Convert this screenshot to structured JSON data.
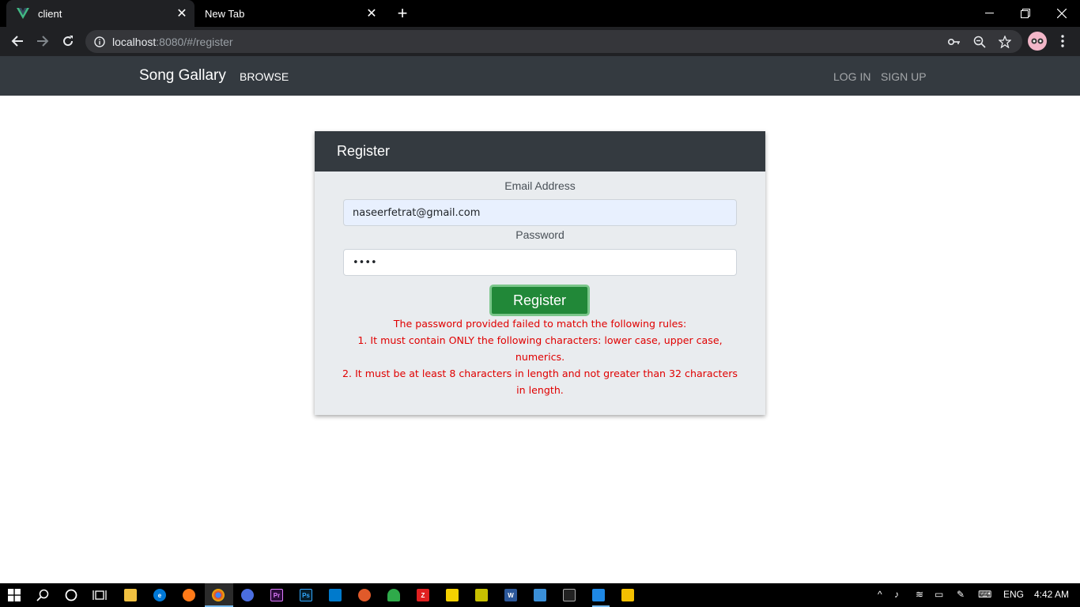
{
  "browser": {
    "tabs": [
      {
        "title": "client",
        "active": true
      },
      {
        "title": "New Tab",
        "active": false
      }
    ],
    "url_host": "localhost",
    "url_rest": ":8080/#/register"
  },
  "navbar": {
    "brand": "Song Gallary",
    "browse": "BROWSE",
    "login": "LOG IN",
    "signup": "SIGN UP"
  },
  "register": {
    "title": "Register",
    "email_label": "Email Address",
    "email_value": "naseerfetrat@gmail.com",
    "password_label": "Password",
    "password_value": "••••",
    "button_label": "Register",
    "errors": [
      "The password provided failed to match the following rules:",
      "1. It must contain ONLY the following characters: lower case, upper case, numerics.",
      "2. It must be at least 8 characters in length and not greater than 32 characters in length."
    ]
  },
  "taskbar": {
    "language": "ENG",
    "time": "4:42 AM"
  },
  "colors": {
    "navbar": "#343a40",
    "card_bg": "#e9ecef",
    "button": "#218838",
    "error": "#e00000"
  }
}
